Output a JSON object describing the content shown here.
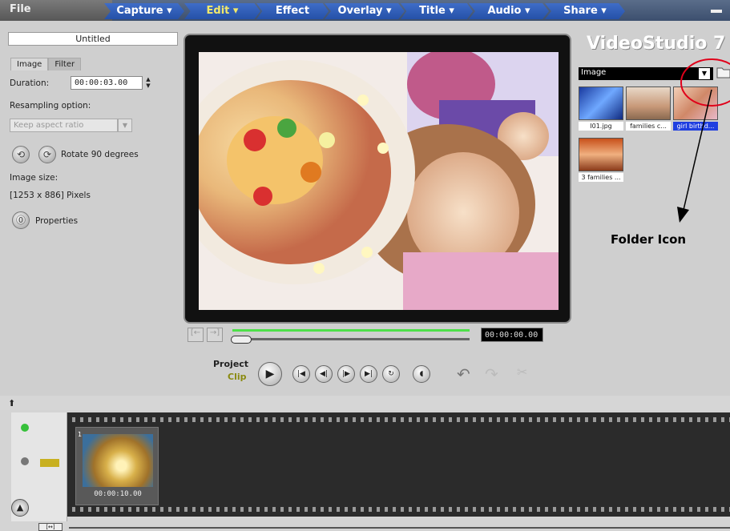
{
  "menu": {
    "file": "File",
    "tabs": [
      {
        "label": "Capture ▾"
      },
      {
        "label": "Edit ▾"
      },
      {
        "label": "Effect"
      },
      {
        "label": "Overlay ▾"
      },
      {
        "label": "Title ▾"
      },
      {
        "label": "Audio ▾"
      },
      {
        "label": "Share ▾"
      }
    ],
    "active_tab": "Edit"
  },
  "options": {
    "title_value": "Untitled",
    "tabs": [
      "Image",
      "Filter"
    ],
    "duration_label": "Duration:",
    "duration_value": "00:00:03.00",
    "resampling_label": "Resampling option:",
    "resampling_value": "Keep aspect ratio",
    "rotate_label": "Rotate 90 degrees",
    "image_size_label": "Image size:",
    "image_size_value": "[1253 x 886] Pixels",
    "properties_label": "Properties"
  },
  "preview": {
    "timecode": "00:00:00.00"
  },
  "transport": {
    "project_label": "Project",
    "clip_label": "Clip"
  },
  "library": {
    "logo": "VideoStudio 7",
    "category": "Image",
    "items": [
      {
        "label": "I01.jpg",
        "selected": false
      },
      {
        "label": "families c...",
        "selected": false
      },
      {
        "label": "girl birthd...",
        "selected": true
      },
      {
        "label": "3 families ...",
        "selected": false
      }
    ]
  },
  "annotation": {
    "label": "Folder Icon",
    "color": "#e0001a"
  },
  "timeline": {
    "clip_index": "1",
    "clip_duration": "00:00:10.00"
  },
  "colors": {
    "menu_tab": "#2f5fbf",
    "active_tab_text": "#f2e96a",
    "selected_item": "#1f3fe0",
    "scrub_green": "#4ee049"
  }
}
